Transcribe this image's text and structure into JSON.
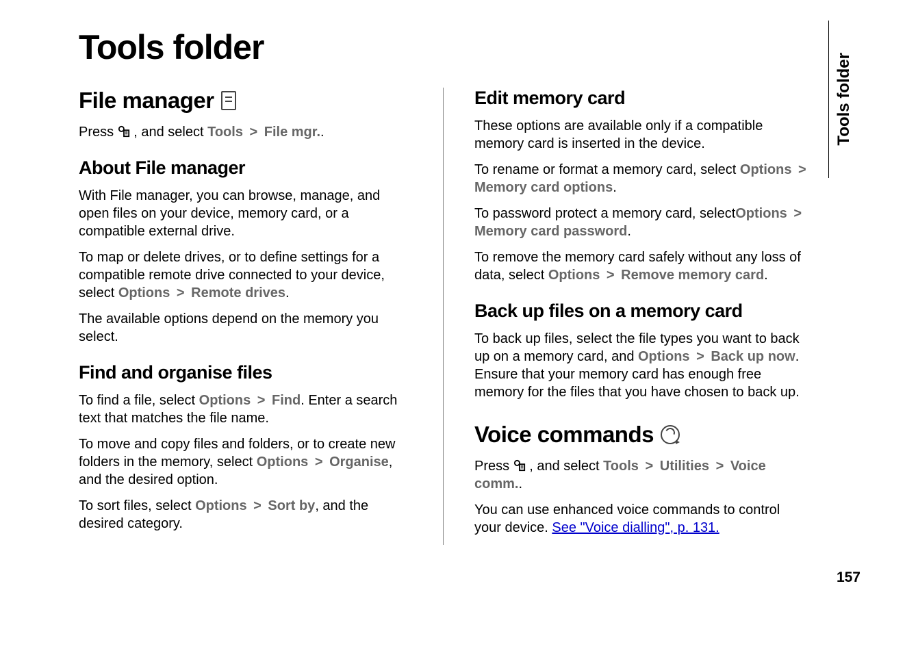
{
  "page": {
    "title": "Tools folder",
    "sideTab": "Tools folder",
    "pageNumber": "157"
  },
  "left": {
    "fileManager": {
      "heading": "File manager",
      "pressText": "Press ",
      "pressAfter": " , and select ",
      "tools": "Tools",
      "sep": " > ",
      "fileMgr": "File mgr.",
      "period": "."
    },
    "about": {
      "heading": "About File manager",
      "p1": "With File manager, you can browse, manage, and open files on your device, memory card, or a compatible external drive.",
      "p2a": "To map or delete drives, or to define settings for a compatible remote drive connected to your device, select ",
      "options": "Options",
      "sep": " > ",
      "remoteDrives": "Remote drives",
      "period": ".",
      "p3": "The available options depend on the memory you select."
    },
    "find": {
      "heading": "Find and organise files",
      "p1a": "To find a file, select ",
      "options": "Options",
      "sep": " > ",
      "find": "Find",
      "p1b": ". Enter a search text that matches the file name.",
      "p2a": "To move and copy files and folders, or to create new folders in the memory, select ",
      "organise": "Organise",
      "p2b": ", and the desired option.",
      "p3a": "To sort files, select ",
      "sortBy": "Sort by",
      "p3b": ", and the desired category."
    }
  },
  "right": {
    "edit": {
      "heading": "Edit memory card",
      "p1": "These options are available only if a compatible memory card is inserted in the device.",
      "p2a": "To rename or format a memory card, select ",
      "options": "Options",
      "sep": " > ",
      "memCardOptions": "Memory card options",
      "period": ".",
      "p3a": "To password protect a memory card, select",
      "memCardPassword": "Memory card password",
      "p4a": "To remove the memory card safely without any loss of data, select ",
      "removeCard": "Remove memory card"
    },
    "backup": {
      "heading": "Back up files on a memory card",
      "p1a": "To back up files, select the file types you want to back up on a memory card, and ",
      "options": "Options",
      "sep": " > ",
      "backupNow": "Back up now",
      "p1b": ". Ensure that your memory card has enough free memory for the files that you have chosen to back up."
    },
    "voice": {
      "heading": "Voice commands",
      "pressText": "Press ",
      "pressAfter": " , and select ",
      "tools": "Tools",
      "sep": " > ",
      "utilities": "Utilities",
      "voiceComm": "Voice comm.",
      "period": ".",
      "p2a": "You can use enhanced voice commands to control your device. ",
      "link": "See \"Voice dialling\", p. 131."
    }
  }
}
